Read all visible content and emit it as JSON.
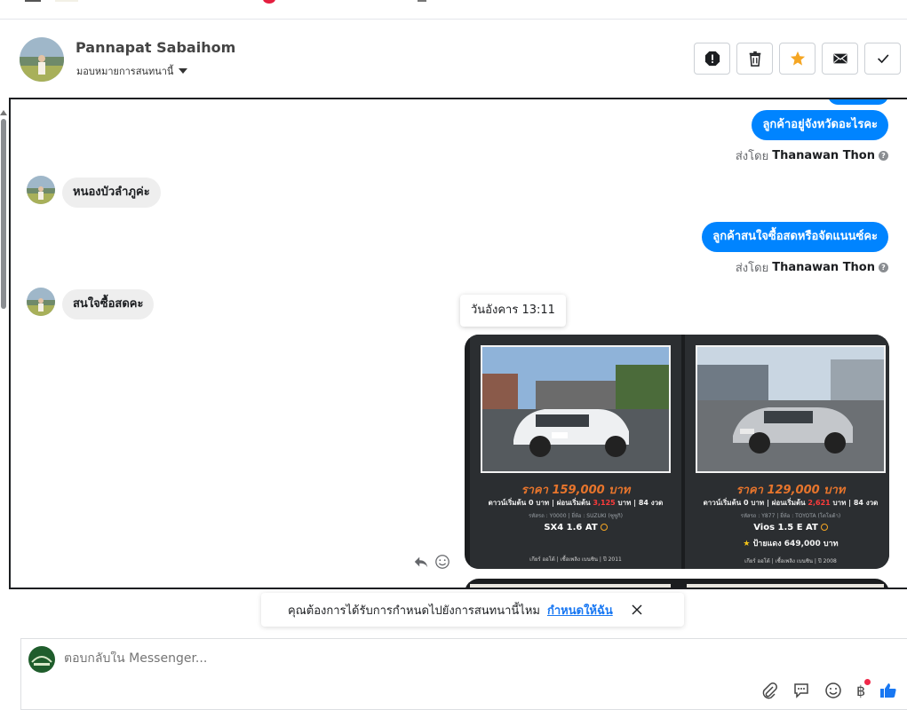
{
  "header": {
    "contact_name": "Pannapat Sabaihom",
    "assign_label": "มอบหมายการสนทนานี้",
    "actions": [
      "mark-spam",
      "delete",
      "star",
      "mark-unread",
      "mark-done"
    ]
  },
  "messages": {
    "out1": {
      "text": "ลูกค้าอยู่จังหวัดอะไรคะ",
      "sent_by_prefix": "ส่งโดย",
      "sent_by_name": "Thanawan Thon"
    },
    "in1": {
      "text": "หนองบัวลำภูค่ะ"
    },
    "out2": {
      "text": "ลูกค้าสนใจซื้อสดหรือจัดแนนซ์คะ",
      "sent_by_prefix": "ส่งโดย",
      "sent_by_name": "Thanawan Thon"
    },
    "in2": {
      "text": "สนใจซื้อสดคะ"
    },
    "timestamp_tooltip": "วันอังคาร 13:11"
  },
  "carousel": {
    "cards": [
      {
        "price": "ราคา 159,000 บาท",
        "down_pre": "ดาวน์เริ่มต้น 0 บาท | ผ่อนเริ่มต้น ",
        "installment": "3,125",
        "down_post": " บาท | 84 งวด",
        "meta": "รหัสรถ : Y0000 | ยี่ห้อ : SUZUKI (ซูซูกิ)",
        "model": "SX4 1.6 AT",
        "plate": "",
        "foot": "เกียร์ ออโต้ | เชื้อเพลิง เบนซิน | ปี 2011"
      },
      {
        "price": "ราคา 129,000 บาท",
        "down_pre": "ดาวน์เริ่มต้น 0 บาท | ผ่อนเริ่มต้น ",
        "installment": "2,621",
        "down_post": " บาท | 84 งวด",
        "meta": "รหัสรถ : Y877 | ยี่ห้อ : TOYOTA (โตโยต้า)",
        "model": "Vios 1.5 E AT",
        "plate": "ป้ายแดง 649,000 บาท",
        "foot": "เกียร์ ออโต้ | เชื้อเพลิง เบนซิน | ปี 2008"
      }
    ]
  },
  "suggestion": {
    "text": "คุณต้องการได้รับการกำหนดไปยังการสนทนานี้ไหม",
    "link": "กำหนดให้ฉัน"
  },
  "composer": {
    "placeholder": "ตอบกลับใน Messenger..."
  },
  "colors": {
    "accent": "#0084ff",
    "link": "#1877f2",
    "price": "#e8752c",
    "installment_red": "#ff3b3b",
    "star": "#f5a623"
  }
}
